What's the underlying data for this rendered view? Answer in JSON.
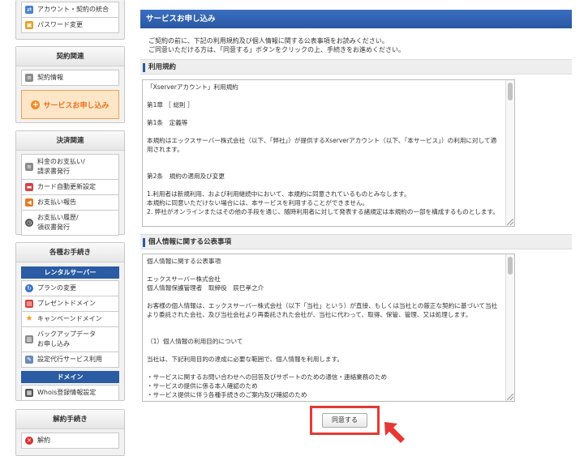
{
  "sidebar": {
    "top_items": [
      {
        "label": "アカウント・契約の統合",
        "icon": "merge-icon"
      },
      {
        "label": "パスワード変更",
        "icon": "lock-icon"
      }
    ],
    "contract": {
      "title": "契約関連",
      "items": [
        {
          "label": "契約情報",
          "icon": "document-icon"
        }
      ],
      "apply_label": "サービスお申し込み"
    },
    "payment": {
      "title": "決済関連",
      "items": [
        {
          "label": "料金のお支払い/\n請求書発行",
          "icon": "invoice-icon"
        },
        {
          "label": "カード自動更新設定",
          "icon": "card-icon"
        },
        {
          "label": "お支払い報告",
          "icon": "megaphone-icon"
        },
        {
          "label": "お支払い履歴/\n領収書発行",
          "icon": "clock-icon"
        }
      ]
    },
    "procedures": {
      "title": "各種お手続き",
      "rental_title": "レンタルサーバー",
      "rental_items": [
        {
          "label": "プランの変更",
          "icon": "refresh-icon"
        },
        {
          "label": "プレゼントドメイン",
          "icon": "gift-icon"
        },
        {
          "label": "キャンペーンドメイン",
          "icon": "star-icon"
        },
        {
          "label": "バックアップデータ\nお申し込み",
          "icon": "backup-icon"
        },
        {
          "label": "設定代行サービス利用",
          "icon": "wrench-icon"
        }
      ],
      "domain_title": "ドメイン",
      "domain_items": [
        {
          "label": "Whois登録情報設定",
          "icon": "whois-icon"
        }
      ]
    },
    "cancel": {
      "title": "解約手続き",
      "items": [
        {
          "label": "解約",
          "icon": "cancel-icon"
        }
      ]
    }
  },
  "main": {
    "title": "サービスお申し込み",
    "intro": [
      "ご契約の前に、下記の利用規約及び個人情報に関する公表事項をお読みください。",
      "ご同意いただける方は、「同意する」ボタンをクリックの上、手続きをお進めください。"
    ],
    "terms": {
      "heading": "利用規約",
      "lines": [
        "「Xserverアカウント」利用規約",
        "",
        "第1章 ［ 総則 ］",
        "",
        "第1条　定義等",
        "",
        "本規約はエックスサーバー株式会社（以下、「弊社」）が提供するXserverアカウント（以下、「本サービス」）の利用に対して適用されます。",
        "",
        "",
        "第2条　規約の適用及び変更",
        "",
        "1.利用者は新規利用、および利用継続中において、本規約に同意されているものとみなします。",
        "本規約に同意いただけない場合には、本サービスを利用することができません。",
        "2. 弊社がオンラインまたはその他の手段を通じ、随時利用者に対して発表する諸規定は本規約の一部を構成するものとします。"
      ]
    },
    "privacy": {
      "heading": "個人情報に関する公表事項",
      "lines": [
        "個人情報に関する公表事項",
        "",
        "エックスサーバー株式会社",
        "個人情報保護管理者　取締役　辰巳孝之介",
        "",
        "お客様の個人情報は、エックスサーバー株式会社（以下「当社」という）が直接、もしくは当社との厳正な契約に基づいて当社より委託された会社、及び当社会社より再委託された会社が、当社に代わって、取得、保管、管理、又は処理します。",
        "",
        "",
        "（1）個人情報の利用目的について",
        "",
        "当社は、下記利用目的の達成に必要な範囲で、個人情報を利用します。",
        "",
        "・サービスに関するお問い合わせへの回答及びサポートのための通信・連絡業務のため",
        "・サービスの提供に係る本人確認のため",
        "・サービス提供に伴う各種手続きのご案内及び確認のため"
      ]
    },
    "agree_label": "同意する"
  },
  "colors": {
    "header_blue": "#2a57a2",
    "apply_orange": "#f08a24",
    "highlight_red": "#e53935"
  }
}
